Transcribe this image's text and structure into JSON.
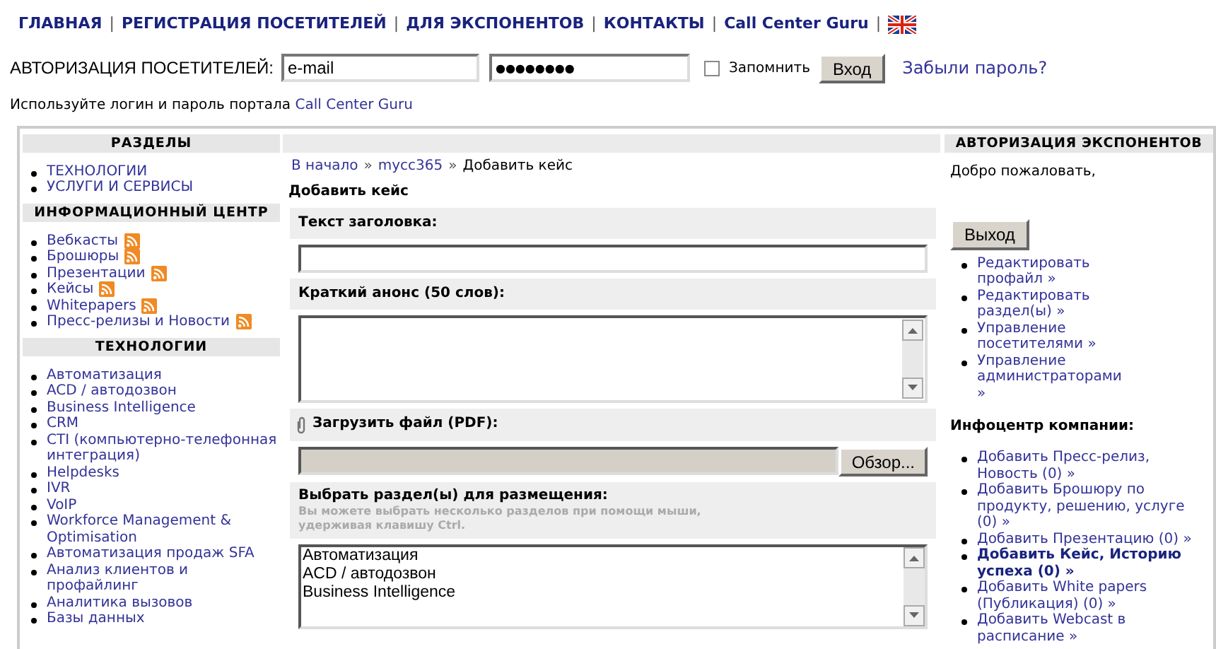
{
  "nav": {
    "separator": "|",
    "items": [
      "ГЛАВНАЯ",
      "РЕГИСТРАЦИЯ ПОСЕТИТЕЛЕЙ",
      "ДЛЯ ЭКСПОНЕНТОВ",
      "КОНТАКТЫ",
      "Call Center Guru"
    ]
  },
  "login": {
    "label": "АВТОРИЗАЦИЯ ПОСЕТИТЕЛЕЙ:",
    "email": "e-mail",
    "password": "●●●●●●●●",
    "remember": {
      "label": "Запомнить",
      "checked": false
    },
    "button": "Вход",
    "forgot": "Забыли пароль?",
    "hint": "Используйте логин и пароль портала",
    "hint_link": "Call Center Guru"
  },
  "left": [
    {
      "title": "РАЗДЕЛЫ",
      "items": [
        {
          "label": "ТЕХНОЛОГИИ",
          "rss": false
        },
        {
          "label": "УСЛУГИ И СЕРВИСЫ",
          "rss": false
        }
      ]
    },
    {
      "title": "ИНФОРМАЦИОННЫЙ ЦЕНТР",
      "items": [
        {
          "label": "Вебкасты",
          "rss": true
        },
        {
          "label": "Брошюры",
          "rss": true
        },
        {
          "label": "Презентации",
          "rss": true
        },
        {
          "label": "Кейсы",
          "rss": true
        },
        {
          "label": "Whitepapers",
          "rss": true
        },
        {
          "label": "Пресс-релизы и Новости",
          "rss": true
        }
      ]
    },
    {
      "title": "ТЕХНОЛОГИИ",
      "items": [
        {
          "label": "Автоматизация",
          "rss": false
        },
        {
          "label": "ACD / автодозвон",
          "rss": false
        },
        {
          "label": "Business Intelligence",
          "rss": false
        },
        {
          "label": "CRM",
          "rss": false
        },
        {
          "label": "CTI (компьютерно-телефонная интеграция)",
          "rss": false
        },
        {
          "label": "Helpdesks",
          "rss": false
        },
        {
          "label": "IVR",
          "rss": false
        },
        {
          "label": "VoIP",
          "rss": false
        },
        {
          "label": "Workforce Management & Optimisation",
          "rss": false
        },
        {
          "label": "Автоматизация продаж SFA",
          "rss": false
        },
        {
          "label": "Анализ клиентов и профайлинг",
          "rss": false
        },
        {
          "label": "Аналитика вызовов",
          "rss": false
        },
        {
          "label": "Базы данных",
          "rss": false
        }
      ]
    }
  ],
  "center": {
    "breadcrumb": {
      "links": [
        "В начало",
        "mycc365"
      ],
      "separator": "»",
      "current": "Добавить кейс"
    },
    "title": "Добавить кейс",
    "title_label": "Текст заголовка:",
    "summary_label": "Краткий анонс (50 слов):",
    "file_label": "Загрузить файл (PDF):",
    "browse": "Обзор...",
    "sections_label": "Выбрать раздел(ы) для размещения:",
    "sections_hint": "Вы можете выбрать несколько разделов при помощи мыши, удерживая клавишу Ctrl.",
    "options": [
      "Автоматизация",
      "ACD / автодозвон",
      "Business Intelligence"
    ]
  },
  "right": {
    "title": "АВТОРИЗАЦИЯ ЭКСПОНЕНТОВ",
    "welcome": "Добро пожаловать,",
    "logout": "Выход",
    "links": [
      "Редактировать профайл »",
      "Редактировать раздел(ы) »",
      "Управление посетителями »",
      "Управление администраторами »"
    ],
    "infocenter": "Инфоцентр компании:",
    "infolinks": [
      {
        "label": "Добавить Пресс-релиз, Новость (0) »",
        "selected": false
      },
      {
        "label": "Добавить Брошюру по продукту, решению, услуге (0) »",
        "selected": false
      },
      {
        "label": "Добавить Презентацию (0) »",
        "selected": false
      },
      {
        "label": "Добавить Кейс, Историю успеха (0) »",
        "selected": true
      },
      {
        "label": "Добавить White papers (Публикация) (0) »",
        "selected": false
      },
      {
        "label": "Добавить Webcast в расписание »",
        "selected": false
      }
    ]
  }
}
